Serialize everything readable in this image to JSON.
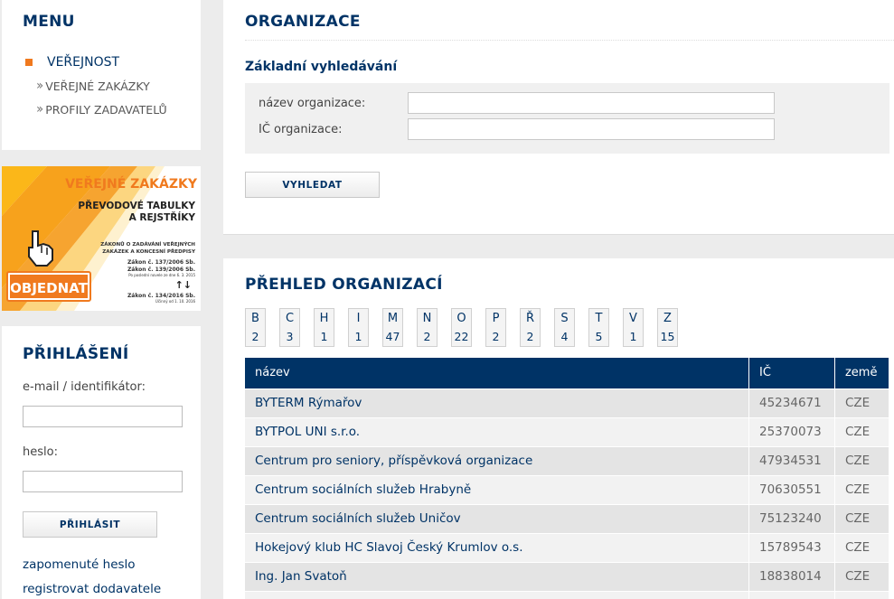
{
  "menu": {
    "title": "MENU",
    "main_item": "VEŘEJNOST",
    "sub_items": [
      "VEŘEJNÉ ZAKÁZKY",
      "PROFILY ZADAVATELŮ"
    ]
  },
  "banner": {
    "title": "VEŘEJNÉ ZAKÁZKY",
    "line1": "PŘEVODOVÉ TABULKY",
    "line2": "A REJSTŘÍKY",
    "text1": "ZÁKONŮ O ZADÁVÁNÍ VEŘEJNÝCH",
    "text2": "ZAKÁZEK A KONCESNÍ PŘEDPISY",
    "law1": "Zákon č. 137/2006 Sb.",
    "law2": "Zákon č. 139/2006 Sb.",
    "law2_note": "Po poslední novele ze dne 6. 3. 2015",
    "law3": "Zákon č. 134/2016 Sb.",
    "law3_note": "Účinný od 1. 10. 2016",
    "cta": "OBJEDNAT",
    "arrows": "↑↓"
  },
  "login": {
    "title": "PŘIHLÁŠENÍ",
    "email_label": "e-mail / identifikátor:",
    "password_label": "heslo:",
    "submit": "PŘIHLÁSIT",
    "forgot": "zapomenuté heslo",
    "register": "registrovat dodavatele"
  },
  "org_search": {
    "title": "ORGANIZACE",
    "subtitle": "Základní vyhledávání",
    "name_label": "název organizace:",
    "ic_label": "IČ organizace:",
    "name_value": "",
    "ic_value": "",
    "button": "VYHLEDAT"
  },
  "overview": {
    "title": "PŘEHLED ORGANIZACÍ",
    "letters": [
      {
        "letter": "B",
        "count": "2"
      },
      {
        "letter": "C",
        "count": "3"
      },
      {
        "letter": "H",
        "count": "1"
      },
      {
        "letter": "I",
        "count": "1"
      },
      {
        "letter": "M",
        "count": "47"
      },
      {
        "letter": "N",
        "count": "2"
      },
      {
        "letter": "O",
        "count": "22"
      },
      {
        "letter": "P",
        "count": "2"
      },
      {
        "letter": "Ř",
        "count": "2"
      },
      {
        "letter": "S",
        "count": "4"
      },
      {
        "letter": "T",
        "count": "5"
      },
      {
        "letter": "V",
        "count": "1"
      },
      {
        "letter": "Z",
        "count": "15"
      }
    ],
    "columns": [
      "název",
      "IČ",
      "země"
    ],
    "rows": [
      {
        "name": "BYTERM Rýmařov",
        "ic": "45234671",
        "country": "CZE"
      },
      {
        "name": "BYTPOL UNI s.r.o.",
        "ic": "25370073",
        "country": "CZE"
      },
      {
        "name": "Centrum pro seniory, příspěvková organizace",
        "ic": "47934531",
        "country": "CZE"
      },
      {
        "name": "Centrum sociálních služeb Hrabyně",
        "ic": "70630551",
        "country": "CZE"
      },
      {
        "name": "Centrum sociálních služeb Uničov",
        "ic": "75123240",
        "country": "CZE"
      },
      {
        "name": "Hokejový klub HC Slavoj Český Krumlov o.s.",
        "ic": "15789543",
        "country": "CZE"
      },
      {
        "name": "Ing. Jan Svatoň",
        "ic": "18838014",
        "country": "CZE"
      }
    ]
  },
  "colors": {
    "brand_blue": "#003366",
    "accent_orange": "#f0791e"
  }
}
